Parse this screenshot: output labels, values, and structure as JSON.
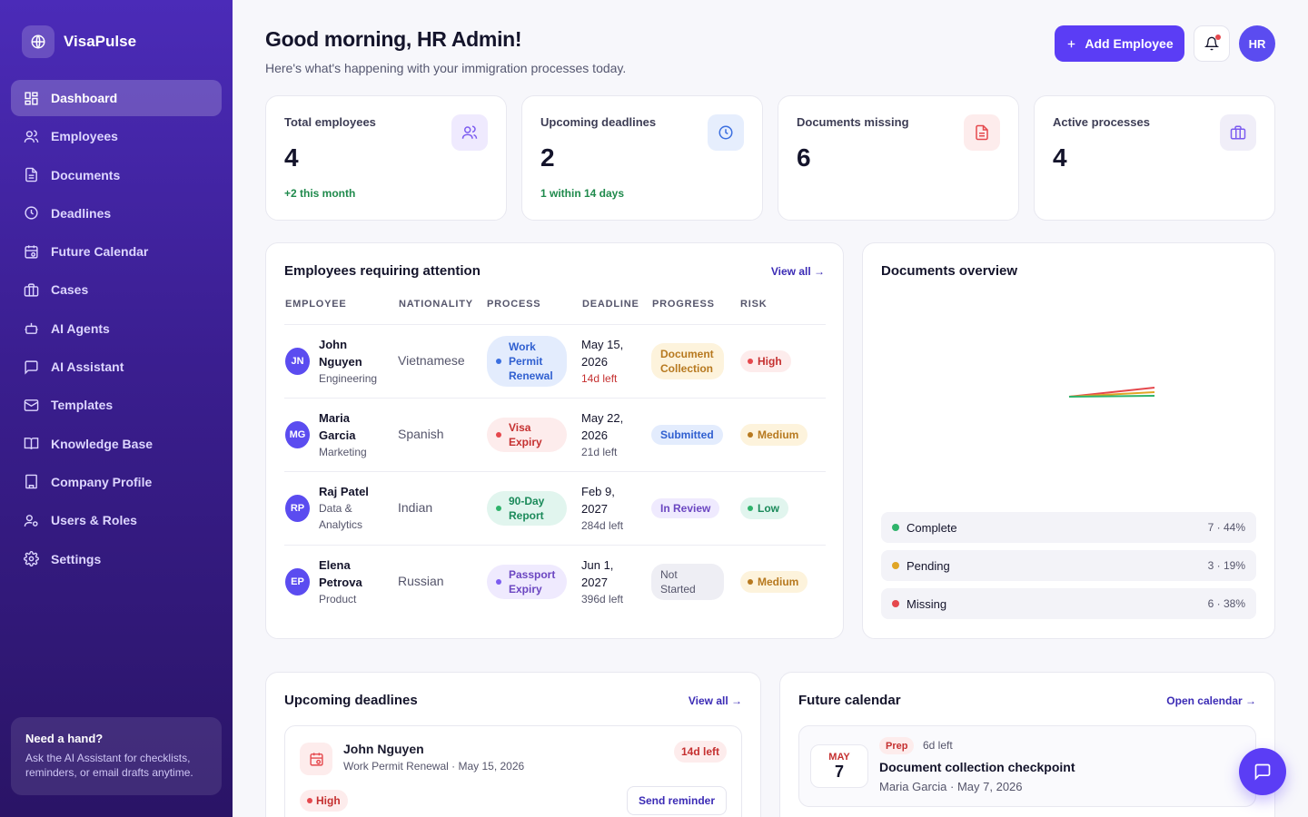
{
  "sidebar": {
    "brand": "VisaPulse",
    "items": [
      {
        "label": "Dashboard",
        "icon": "dashboard-icon"
      },
      {
        "label": "Employees",
        "icon": "users-icon"
      },
      {
        "label": "Documents",
        "icon": "document-icon"
      },
      {
        "label": "Deadlines",
        "icon": "clock-icon"
      },
      {
        "label": "Future Calendar",
        "icon": "calendar-icon"
      },
      {
        "label": "Cases",
        "icon": "briefcase-icon"
      },
      {
        "label": "AI Agents",
        "icon": "robot-icon"
      },
      {
        "label": "AI Assistant",
        "icon": "chat-icon"
      },
      {
        "label": "Templates",
        "icon": "mail-icon"
      },
      {
        "label": "Knowledge Base",
        "icon": "book-icon"
      },
      {
        "label": "Company Profile",
        "icon": "building-icon"
      },
      {
        "label": "Users & Roles",
        "icon": "user-roles-icon"
      },
      {
        "label": "Settings",
        "icon": "gear-icon"
      }
    ],
    "help": {
      "title": "Need a hand?",
      "text": "Ask the AI Assistant for checklists, reminders, or email drafts anytime."
    }
  },
  "header": {
    "greeting": "Good morning, HR Admin!",
    "subtitle": "Here's what's happening with your immigration processes today.",
    "add_button": "Add Employee",
    "avatar": "HR"
  },
  "stats": [
    {
      "label": "Total employees",
      "value": "4",
      "note": "+2 this month",
      "icon": "users-icon",
      "color": "#7c5cf0"
    },
    {
      "label": "Upcoming deadlines",
      "value": "2",
      "note": "1 within 14 days",
      "icon": "clock-icon",
      "color": "#3b6fe0"
    },
    {
      "label": "Documents missing",
      "value": "6",
      "note": "",
      "icon": "document-icon",
      "color": "#e5484d"
    },
    {
      "label": "Active processes",
      "value": "4",
      "note": "",
      "icon": "briefcase-icon",
      "color": "#7c5cf0"
    }
  ],
  "attention": {
    "title": "Employees requiring attention",
    "view_all": "View all →",
    "columns": [
      "EMPLOYEE",
      "NATIONALITY",
      "PROCESS",
      "DEADLINE",
      "PROGRESS",
      "RISK"
    ],
    "rows": [
      {
        "initials": "JN",
        "name": "John Nguyen",
        "dept": "Engineering",
        "nationality": "Vietnamese",
        "process": "Work Permit Renewal",
        "date": "May 15, 2026",
        "left": "14d left",
        "progress": "Document Collection",
        "risk": "High"
      },
      {
        "initials": "MG",
        "name": "Maria Garcia",
        "dept": "Marketing",
        "nationality": "Spanish",
        "process": "Visa Expiry",
        "date": "May 22, 2026",
        "left": "21d left",
        "progress": "Submitted",
        "risk": "Medium"
      },
      {
        "initials": "RP",
        "name": "Raj Patel",
        "dept": "Data & Analytics",
        "nationality": "Indian",
        "process": "90-Day Report",
        "date": "Feb 9, 2027",
        "left": "284d left",
        "progress": "In Review",
        "risk": "Low"
      },
      {
        "initials": "EP",
        "name": "Elena Petrova",
        "dept": "Product",
        "nationality": "Russian",
        "process": "Passport Expiry",
        "date": "Jun 1, 2027",
        "left": "396d left",
        "progress": "Not Started",
        "risk": "Medium"
      }
    ]
  },
  "documents": {
    "title": "Documents overview",
    "legend": [
      {
        "label": "Complete",
        "value": "7 · 44%",
        "color": "#2fb36b"
      },
      {
        "label": "Pending",
        "value": "3 · 19%",
        "color": "#e0a526"
      },
      {
        "label": "Missing",
        "value": "6 · 38%",
        "color": "#e5484d"
      }
    ]
  },
  "deadlines": {
    "title": "Upcoming deadlines",
    "view_all": "View all →",
    "item": {
      "name": "John Nguyen",
      "detail": "Work Permit Renewal · May 15, 2026",
      "left": "14d left",
      "risk": "High",
      "action": "Send reminder"
    }
  },
  "calendar": {
    "title": "Future calendar",
    "open": "Open calendar →",
    "item": {
      "month": "MAY",
      "day": "7",
      "tag": "Prep",
      "left": "6d left",
      "title": "Document collection checkpoint",
      "detail": "Maria Garcia · May 7, 2026"
    }
  }
}
